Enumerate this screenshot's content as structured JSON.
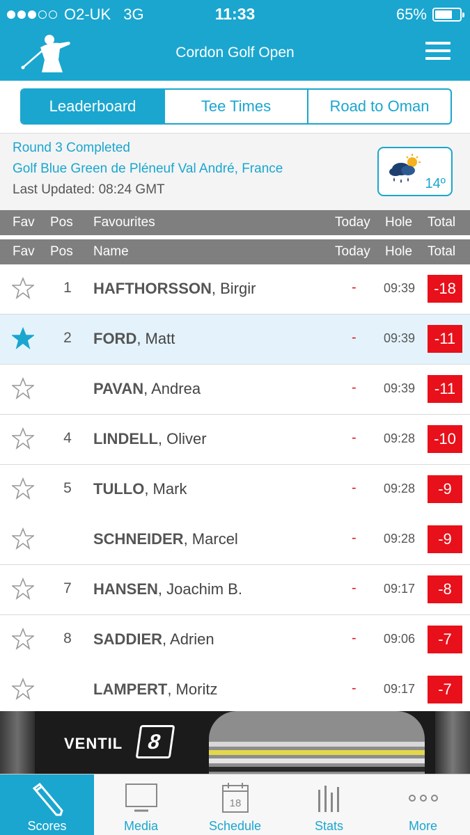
{
  "status_bar": {
    "carrier": "O2-UK",
    "network": "3G",
    "time": "11:33",
    "battery": "65%",
    "battery_level": 0.65,
    "signal_strength": 3
  },
  "header": {
    "title": "Cordon Golf Open",
    "logo": "golfer-logo",
    "menu_icon": "hamburger-icon"
  },
  "tabs": [
    {
      "label": "Leaderboard",
      "active": true
    },
    {
      "label": "Tee Times",
      "active": false
    },
    {
      "label": "Road to Oman",
      "active": false
    }
  ],
  "event": {
    "round_status": "Round 3 Completed",
    "venue": "Golf Blue Green de Pléneuf Val André, France",
    "last_updated": "Last Updated: 08:24 GMT",
    "weather": {
      "icon": "rain-sun-icon",
      "temperature": "14º"
    }
  },
  "favourites_header": {
    "fav": "Fav",
    "pos": "Pos",
    "name": "Favourites",
    "today": "Today",
    "hole": "Hole",
    "total": "Total"
  },
  "leaderboard_header": {
    "fav": "Fav",
    "pos": "Pos",
    "name": "Name",
    "today": "Today",
    "hole": "Hole",
    "total": "Total"
  },
  "players": [
    {
      "pos": "1",
      "surname": "HAFTHORSSON",
      "first": ", Birgir",
      "today": "-",
      "hole": "09:39",
      "total": "-18",
      "fav": false
    },
    {
      "pos": "2",
      "surname": "FORD",
      "first": ", Matt",
      "today": "-",
      "hole": "09:39",
      "total": "-11",
      "fav": true
    },
    {
      "pos": "",
      "surname": "PAVAN",
      "first": ", Andrea",
      "today": "-",
      "hole": "09:39",
      "total": "-11",
      "fav": false
    },
    {
      "pos": "4",
      "surname": "LINDELL",
      "first": ", Oliver",
      "today": "-",
      "hole": "09:28",
      "total": "-10",
      "fav": false
    },
    {
      "pos": "5",
      "surname": "TULLO",
      "first": ", Mark",
      "today": "-",
      "hole": "09:28",
      "total": "-9",
      "fav": false
    },
    {
      "pos": "",
      "surname": "SCHNEIDER",
      "first": ", Marcel",
      "today": "-",
      "hole": "09:28",
      "total": "-9",
      "fav": false
    },
    {
      "pos": "7",
      "surname": "HANSEN",
      "first": ", Joachim B.",
      "today": "-",
      "hole": "09:17",
      "total": "-8",
      "fav": false
    },
    {
      "pos": "8",
      "surname": "SADDIER",
      "first": ", Adrien",
      "today": "-",
      "hole": "09:06",
      "total": "-7",
      "fav": false
    },
    {
      "pos": "",
      "surname": "LAMPERT",
      "first": ", Moritz",
      "today": "-",
      "hole": "09:17",
      "total": "-7",
      "fav": false
    }
  ],
  "ad": {
    "brand": "VENTIL",
    "badge": "8"
  },
  "bottom_nav": [
    {
      "label": "Scores",
      "icon": "pencil-icon",
      "active": true
    },
    {
      "label": "Media",
      "icon": "monitor-icon",
      "active": false
    },
    {
      "label": "Schedule",
      "icon": "calendar-icon",
      "active": false,
      "calendar_day": "18"
    },
    {
      "label": "Stats",
      "icon": "bar-stats-icon",
      "active": false
    },
    {
      "label": "More",
      "icon": "more-dots-icon",
      "active": false
    }
  ],
  "colors": {
    "accent": "#1aa6cf",
    "score_red": "#e8101a",
    "header_grey": "#7f7f7f",
    "favourite_row": "#e4f3fb"
  }
}
